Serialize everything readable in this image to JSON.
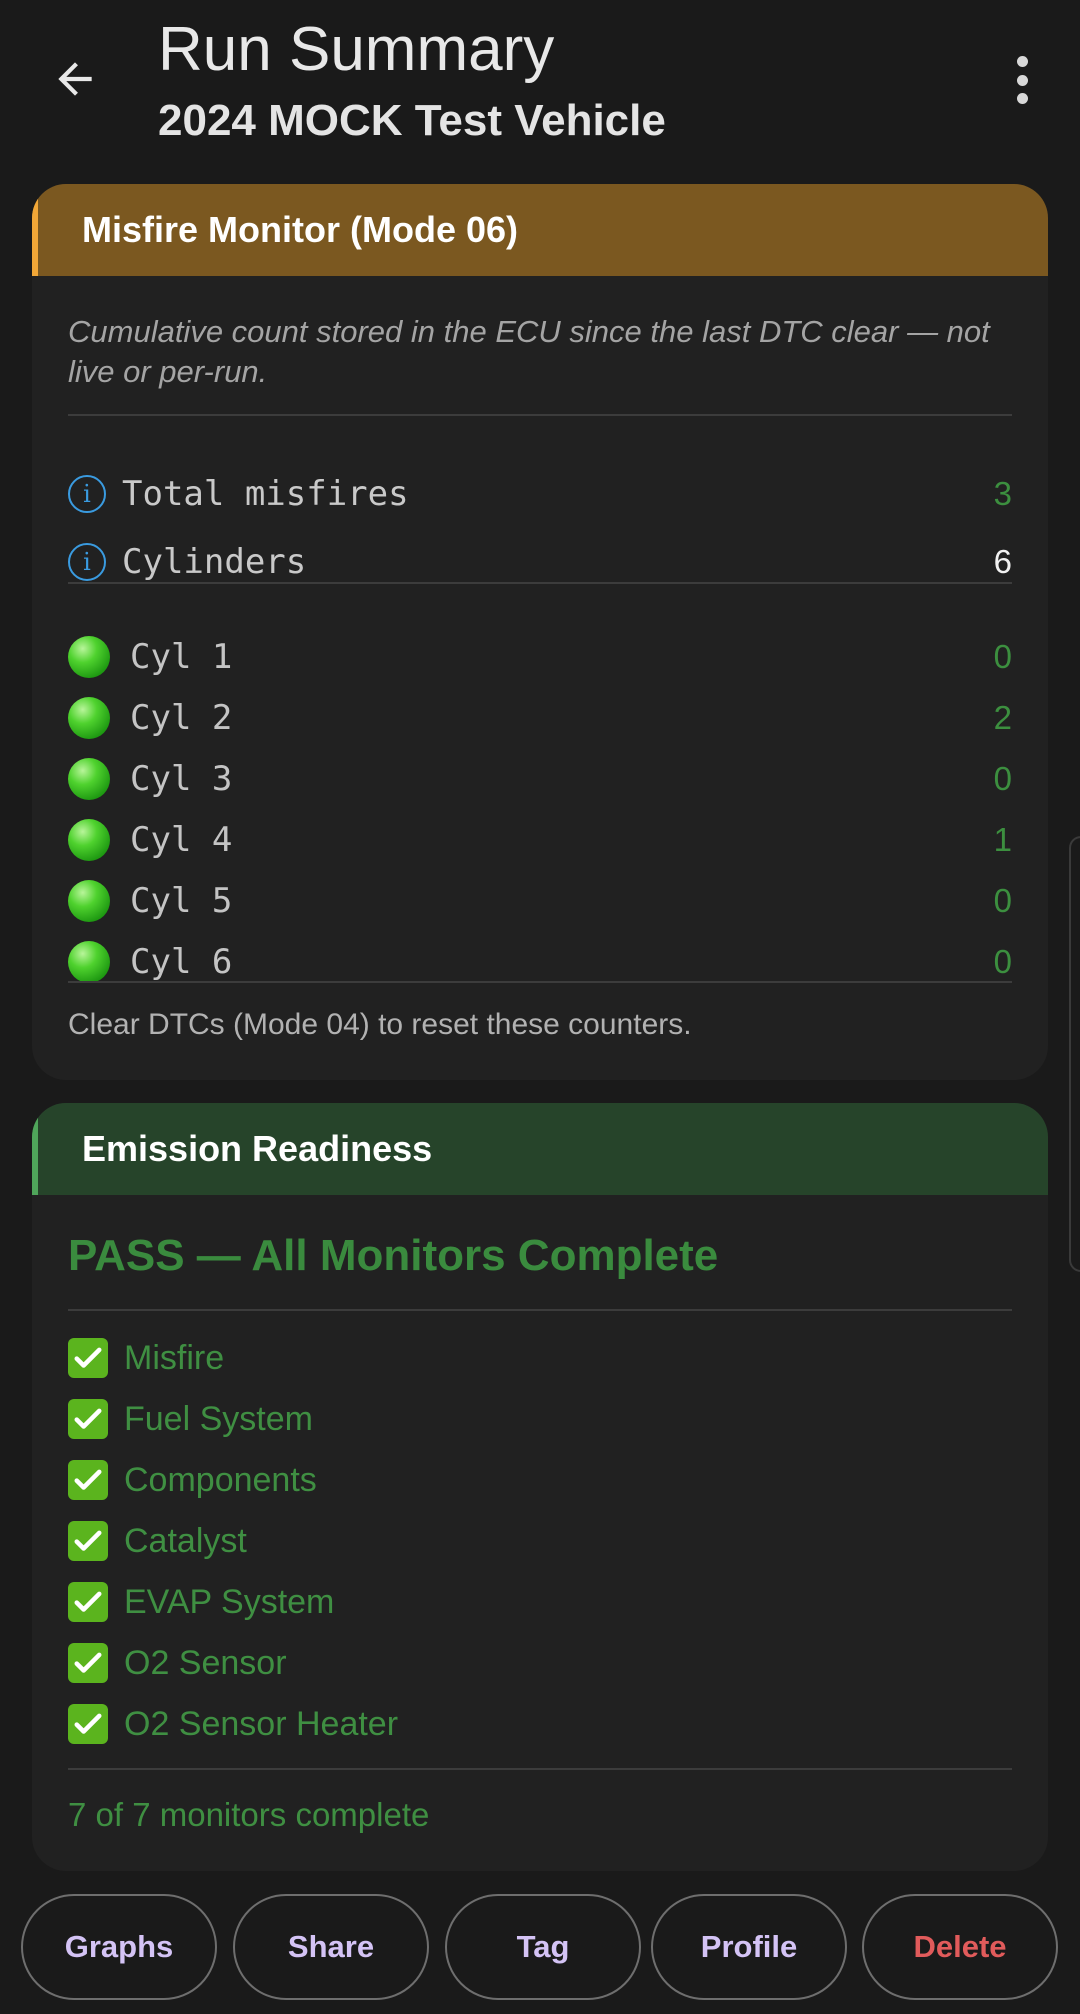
{
  "header": {
    "title": "Run Summary",
    "subtitle": "2024 MOCK Test Vehicle",
    "back_icon": "arrow-left-icon",
    "menu_icon": "more-vertical-icon"
  },
  "misfire": {
    "title": "Misfire Monitor (Mode 06)",
    "note": "Cumulative count stored in the ECU since the last DTC clear — not live or per-run.",
    "total_label": "Total misfires",
    "total_value": "3",
    "cylinders_label": "Cylinders",
    "cylinders_value": "6",
    "cylinders": [
      {
        "label": "Cyl 1",
        "value": "0"
      },
      {
        "label": "Cyl 2",
        "value": "2"
      },
      {
        "label": "Cyl 3",
        "value": "0"
      },
      {
        "label": "Cyl 4",
        "value": "1"
      },
      {
        "label": "Cyl 5",
        "value": "0"
      },
      {
        "label": "Cyl 6",
        "value": "0"
      }
    ],
    "footnote": "Clear DTCs (Mode 04) to reset these counters.",
    "accent_color": "#f2a737",
    "header_color": "#7b5820"
  },
  "emission": {
    "title": "Emission Readiness",
    "status": "PASS — All Monitors Complete",
    "monitors": [
      {
        "label": "Misfire"
      },
      {
        "label": "Fuel System"
      },
      {
        "label": "Components"
      },
      {
        "label": "Catalyst"
      },
      {
        "label": "EVAP System"
      },
      {
        "label": "O2 Sensor"
      },
      {
        "label": "O2 Sensor Heater"
      }
    ],
    "summary": "7 of 7 monitors complete",
    "accent_color": "#4fa55a",
    "header_color": "#26442a",
    "status_color": "#3a8b3e"
  },
  "actions": {
    "graphs": "Graphs",
    "share": "Share",
    "tag": "Tag",
    "profile": "Profile",
    "delete": "Delete"
  }
}
